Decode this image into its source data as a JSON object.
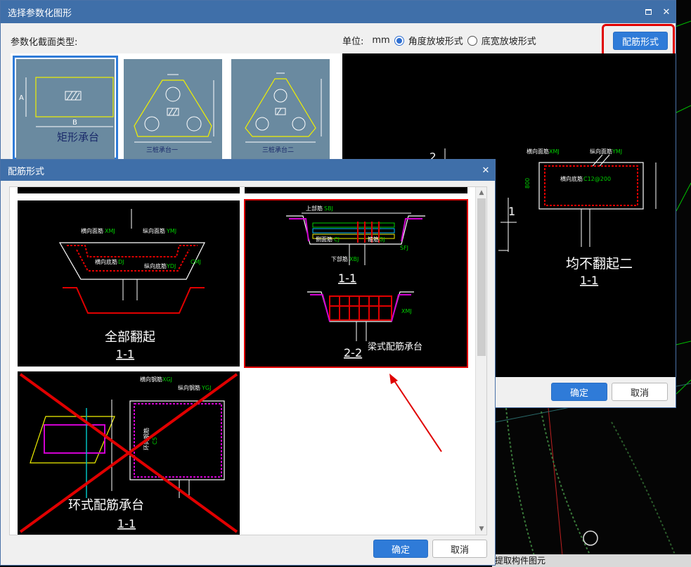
{
  "main_dialog": {
    "title": "选择参数化图形",
    "section_label": "参数化截面类型:",
    "unit_label": "单位:",
    "unit_value": "mm",
    "radio_angle": "角度放坡形式",
    "radio_width": "底宽放坡形式",
    "rebar_button": "配筋形式",
    "ok": "确定",
    "cancel": "取消",
    "shapes": [
      {
        "label": "矩形承台",
        "a": "A",
        "b": "B"
      },
      {
        "label": "三桩承台一"
      },
      {
        "label": "三桩承台二"
      }
    ],
    "preview": {
      "label_transverse": "横向面筋",
      "code_transverse": "XMJ",
      "label_longitudinal": "纵向面筋",
      "code_longitudinal": "YMJ",
      "label_bottom": "横向底筋",
      "code_bottom": "C12@200",
      "caption": "均不翻起二",
      "section": "1-1",
      "num2": "2",
      "num1": "1",
      "dim800": "800"
    }
  },
  "rebar_dialog": {
    "title": "配筋形式",
    "ok": "确定",
    "cancel": "取消",
    "options": [
      {
        "caption": "全部翻起",
        "section": "1-1",
        "lbl_a": "横向面筋",
        "code_a": "XMJ",
        "lbl_b": "纵向面筋",
        "code_b": "YMJ",
        "lbl_c": "横向底筋",
        "code_c": "DJ",
        "lbl_d": "纵向底筋",
        "code_d": "YDJ",
        "code_e": "CMJ"
      },
      {
        "caption": "梁式配筋承台",
        "section_a": "1-1",
        "section_b": "2-2",
        "lbl_top": "上部筋",
        "code_top": "SBJ",
        "lbl_side": "侧面筋",
        "code_side": "CJ",
        "lbl_bottom": "下部筋",
        "code_bottom": "XBJ",
        "lbl_stirrup": "箍筋",
        "code_stirrup": "GJ",
        "code_sfj": "SFJ",
        "code_xmj": "XMJ"
      },
      {
        "caption": "环式配筋承台",
        "section": "1-1",
        "lbl_a": "横向钢筋",
        "code_a": "XGJ",
        "lbl_b": "纵向钢筋",
        "code_b": "YGJ",
        "lbl_c": "环向钢筋",
        "code_c": "C5"
      }
    ]
  },
  "background": {
    "status_text": "提取构件图元"
  },
  "colors": {
    "title_bar": "#3f6fa9",
    "primary_button": "#2f7bd8",
    "highlight": "#e00000"
  }
}
